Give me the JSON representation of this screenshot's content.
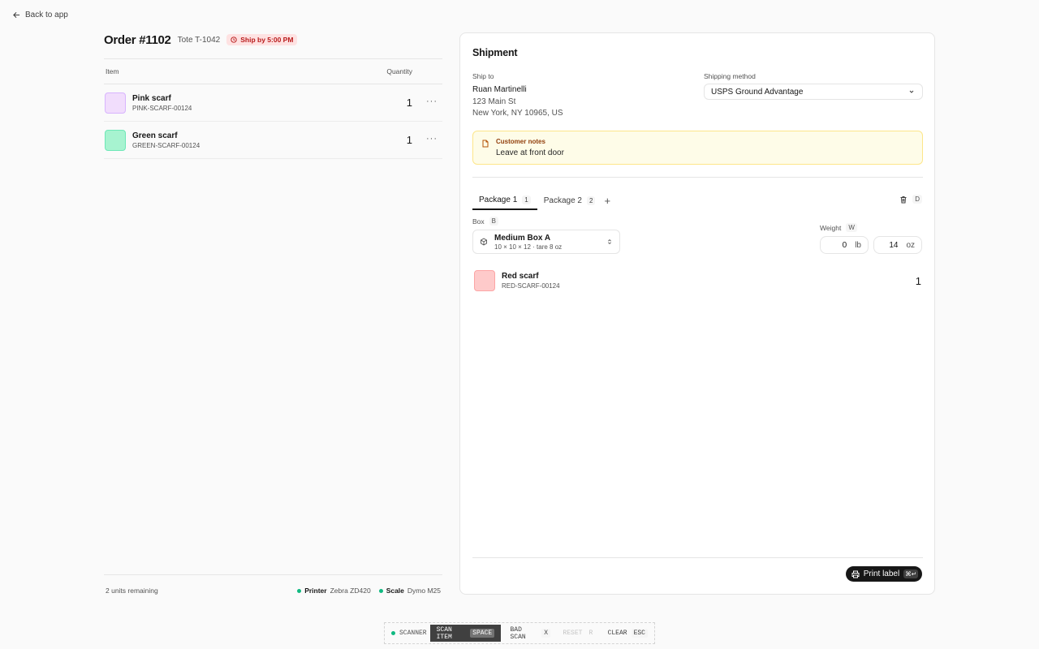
{
  "nav": {
    "back_label": "Back to app"
  },
  "order": {
    "title": "Order #1102",
    "tote": "Tote T-1042",
    "ship_by": "Ship by 5:00 PM"
  },
  "items_table": {
    "col_item": "Item",
    "col_quantity": "Quantity",
    "rows": [
      {
        "name": "Pink scarf",
        "sku": "PINK-SCARF-00124",
        "quantity": "1",
        "color": "#f1ddfc",
        "border": "#d8b4fe"
      },
      {
        "name": "Green scarf",
        "sku": "GREEN-SCARF-00124",
        "quantity": "1",
        "color": "#a7f3d0",
        "border": "#6ee7b7"
      }
    ]
  },
  "footer": {
    "remaining": "2 units remaining",
    "printer_label": "Printer",
    "printer_value": "Zebra ZD420",
    "scale_label": "Scale",
    "scale_value": "Dymo M25"
  },
  "shipment": {
    "title": "Shipment",
    "ship_to_label": "Ship to",
    "ship_to_name": "Ruan Martinelli",
    "ship_to_street": "123 Main St",
    "ship_to_city": "New York, NY 10965, US",
    "shipping_method_label": "Shipping method",
    "shipping_method_value": "USPS Ground Advantage",
    "notes_title": "Customer notes",
    "notes_body": "Leave at front door",
    "tabs": [
      {
        "label": "Package 1",
        "count": "1"
      },
      {
        "label": "Package 2",
        "count": "2"
      }
    ],
    "delete_key": "D",
    "box_label": "Box",
    "box_key": "B",
    "box_name": "Medium Box A",
    "box_detail": "10 × 10 × 12 · tare 8 oz",
    "weight_label": "Weight",
    "weight_key": "W",
    "weight_lb": "0",
    "weight_lb_unit": "lb",
    "weight_oz": "14",
    "weight_oz_unit": "oz",
    "package_items": [
      {
        "name": "Red scarf",
        "sku": "RED-SCARF-00124",
        "quantity": "1",
        "color": "#fecaca",
        "border": "#fca5a5"
      }
    ],
    "print_label": "Print label",
    "print_key": "⌘↵"
  },
  "scanbar": {
    "scanner": "SCANNER",
    "scan_item": "SCAN ITEM",
    "scan_item_key": "SPACE",
    "bad_scan": "BAD SCAN",
    "bad_scan_key": "X",
    "reset": "RESET",
    "reset_key": "R",
    "clear": "CLEAR",
    "clear_key": "ESC"
  },
  "colors": {
    "accent": "#171717",
    "status_ok": "#10b981",
    "badge_bg": "#fee2e2",
    "badge_text": "#b91c1c",
    "notes_bg": "#fefce8"
  }
}
